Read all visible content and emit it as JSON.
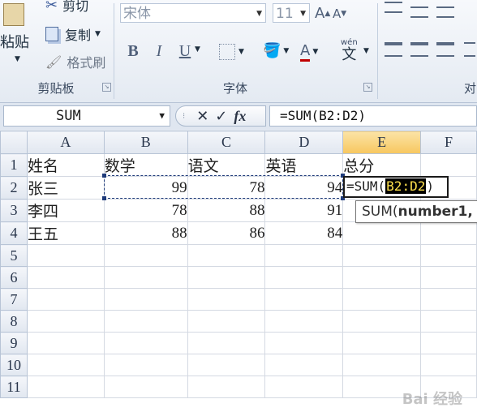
{
  "ribbon": {
    "clipboard": {
      "paste_label": "粘贴",
      "cut_label": "剪切",
      "copy_label": "复制",
      "format_painter_label": "格式刷",
      "group_label": "剪贴板"
    },
    "font": {
      "font_name": "宋体",
      "font_size": "11",
      "grow_font": "A",
      "shrink_font": "A",
      "bold": "B",
      "italic": "I",
      "underline": "U",
      "font_color": "A",
      "phonetic_glyph": "wén",
      "phonetic_char": "文",
      "group_label": "字体"
    },
    "alignment": {
      "group_label_partial": "对"
    }
  },
  "formula_bar": {
    "name_box": "SUM",
    "cancel_glyph": "✕",
    "enter_glyph": "✓",
    "fx_label": "fx",
    "formula": "=SUM(B2:D2)"
  },
  "grid": {
    "columns": [
      "A",
      "B",
      "C",
      "D",
      "E",
      "F"
    ],
    "selected_column": "E",
    "row_numbers": [
      "1",
      "2",
      "3",
      "4",
      "5",
      "6",
      "7",
      "8",
      "9",
      "10",
      "11"
    ],
    "rows": [
      [
        "姓名",
        "数学",
        "语文",
        "英语",
        "总分",
        ""
      ],
      [
        "张三",
        "99",
        "78",
        "94",
        "",
        ""
      ],
      [
        "李四",
        "78",
        "88",
        "91",
        "",
        ""
      ],
      [
        "王五",
        "88",
        "86",
        "84",
        "",
        ""
      ],
      [
        "",
        "",
        "",
        "",
        "",
        ""
      ],
      [
        "",
        "",
        "",
        "",
        "",
        ""
      ],
      [
        "",
        "",
        "",
        "",
        "",
        ""
      ],
      [
        "",
        "",
        "",
        "",
        "",
        ""
      ],
      [
        "",
        "",
        "",
        "",
        "",
        ""
      ],
      [
        "",
        "",
        "",
        "",
        "",
        ""
      ],
      [
        "",
        "",
        "",
        "",
        "",
        ""
      ]
    ],
    "edit_cell": {
      "prefix": "=SUM(",
      "ref": "B2:D2",
      "suffix": ")"
    },
    "tooltip": {
      "func": "SUM(",
      "arg": "number1,"
    }
  },
  "watermark": "Bai 经验",
  "colors": {
    "selection_header": "#f7c75f",
    "ref_highlight_bg": "#000000",
    "ref_highlight_fg": "#ffe14d",
    "marquee": "#1f3b7a"
  }
}
